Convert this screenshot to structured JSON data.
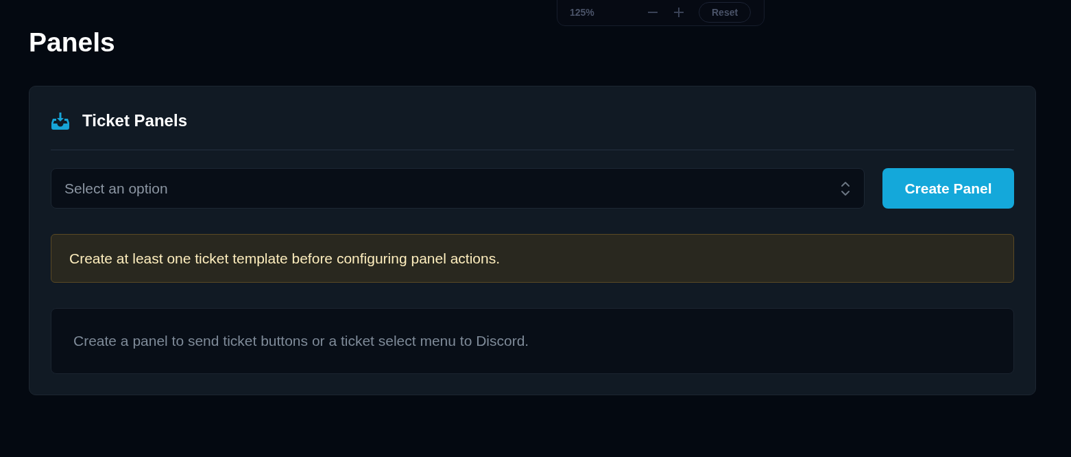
{
  "zoom_toolbar": {
    "zoom": "125%",
    "reset": "Reset"
  },
  "page": {
    "title": "Panels"
  },
  "card": {
    "title": "Ticket Panels",
    "select": {
      "placeholder": "Select an option"
    },
    "create_button": "Create Panel",
    "notice": {
      "kind": "warning",
      "text": "Create at least one ticket template before configuring panel actions."
    },
    "empty_state": "Create a panel to send ticket buttons or a ticket select menu to Discord."
  }
}
